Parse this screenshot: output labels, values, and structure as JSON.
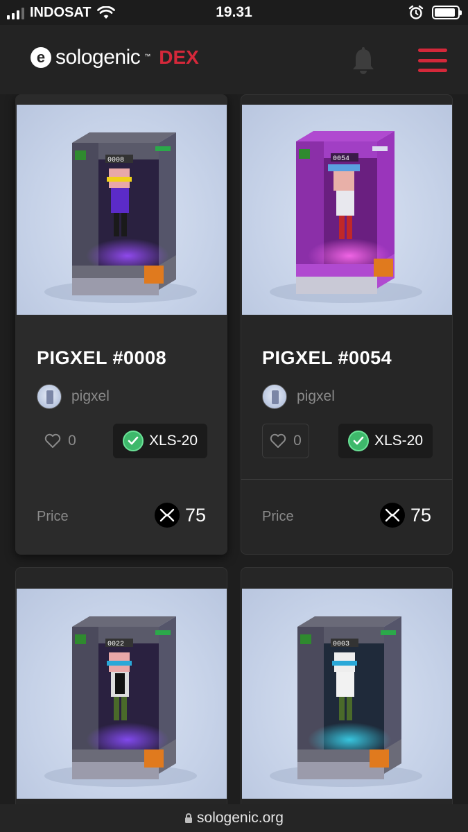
{
  "status_bar": {
    "carrier": "INDOSAT",
    "time": "19.31"
  },
  "header": {
    "logo_mark": "e",
    "logo_text": "sologenic",
    "logo_tm": "™",
    "logo_dex": "DEX",
    "accent_color": "#d4283a",
    "icons": [
      "bell-icon",
      "hamburger-menu-icon"
    ]
  },
  "cards": [
    {
      "title": "PIGXEL #0008",
      "creator": "pigxel",
      "likes": "0",
      "standard": "XLS-20",
      "price_label": "Price",
      "price": "75",
      "case_color": "#4b4a5c",
      "glow_color": "#7b2cf5",
      "number_plate": "0008"
    },
    {
      "title": "PIGXEL #0054",
      "creator": "pigxel",
      "likes": "0",
      "standard": "XLS-20",
      "price_label": "Price",
      "price": "75",
      "case_color": "#8b2fa8",
      "glow_color": "#e04cd8",
      "number_plate": "0054"
    },
    {
      "case_color": "#4b4a5c",
      "glow_color": "#7b2cf5",
      "number_plate": "0022"
    },
    {
      "case_color": "#4b4a5c",
      "glow_color": "#3ad6f0",
      "number_plate": "0003"
    }
  ],
  "url_bar": {
    "url": "sologenic.org"
  }
}
